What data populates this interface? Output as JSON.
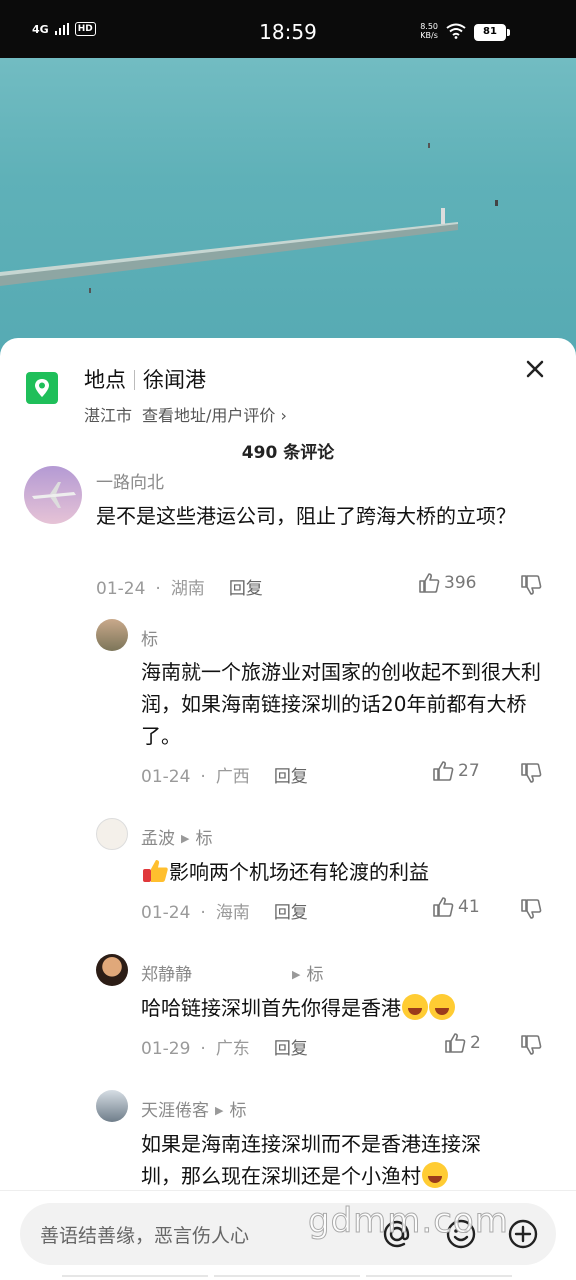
{
  "status_bar": {
    "network": "4G",
    "hd": "HD",
    "time": "18:59",
    "speed_value": "8.50",
    "speed_unit": "KB/s",
    "battery": "81"
  },
  "location": {
    "label": "地点",
    "name": "徐闻港",
    "city": "湛江市",
    "link": "查看地址/用户评价 ›"
  },
  "comments_count": "490 条评论",
  "comments": [
    {
      "user": "一路向北",
      "text": "是不是这些港运公司，阻止了跨海大桥的立项？",
      "date": "01-24",
      "region": "湖南",
      "reply": "回复",
      "likes": "396"
    },
    {
      "user": "标",
      "text": "海南就一个旅游业对国家的创收起不到很大利润，如果海南链接深圳的话20年前都有大桥了。",
      "date": "01-24",
      "region": "广西",
      "reply": "回复",
      "likes": "27"
    },
    {
      "user": "孟波",
      "reply_to": "标",
      "text": "影响两个机场还有轮渡的利益",
      "date": "01-24",
      "region": "海南",
      "reply": "回复",
      "likes": "41"
    },
    {
      "user": "郑静静",
      "reply_to": "标",
      "text": "哈哈链接深圳首先你得是香港",
      "date": "01-29",
      "region": "广东",
      "reply": "回复",
      "likes": "2"
    },
    {
      "user": "天涯倦客",
      "reply_to": "标",
      "text_line1": "如果是海南连接深圳而不是香港连接深",
      "text_line2": "圳，那么现在深圳还是个小渔村"
    }
  ],
  "bottom": {
    "placeholder": "善语结善缘，恶言伤人心",
    "watermark": "gdmm.com"
  },
  "colors": {
    "accent_green": "#1fbf5a",
    "sea": "#5fb1b8"
  }
}
